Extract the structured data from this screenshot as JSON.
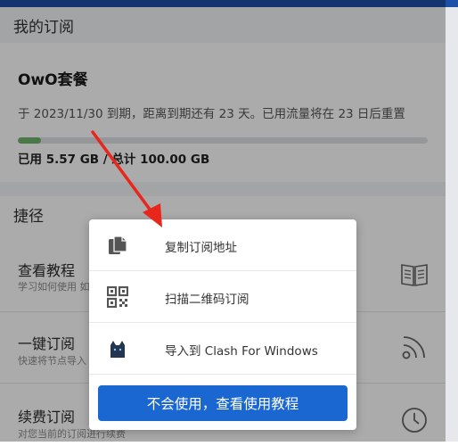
{
  "subscription": {
    "header": "我的订阅",
    "plan_name": "OwO套餐",
    "desc": "于 2023/11/30 到期，距离到期还有 23 天。已用流量将在 23 日后重置",
    "usage": "已用 5.57 GB / 总计 100.00 GB",
    "usage_fraction": 0.0557,
    "progress_color": "#6fb36a"
  },
  "shortcuts": {
    "header": "捷径",
    "items": [
      {
        "title": "查看教程",
        "subtitle": "学习如何使用 如",
        "icon": "book-icon"
      },
      {
        "title": "一键订阅",
        "subtitle": "快速将节点导入",
        "icon": "rss-icon"
      },
      {
        "title": "续费订阅",
        "subtitle": "对您当前的订阅进行续费",
        "icon": "clock-icon"
      }
    ]
  },
  "popup": {
    "items": [
      {
        "label": "复制订阅地址",
        "icon": "copy-icon"
      },
      {
        "label": "扫描二维码订阅",
        "icon": "qrcode-icon"
      },
      {
        "label": "导入到 Clash For Windows",
        "icon": "clash-cat-icon"
      }
    ],
    "button": "不会使用，查看使用教程",
    "button_color": "#1a67d2"
  },
  "colors": {
    "topbar": "#1c4fa6",
    "annotation_arrow": "#e8261b"
  }
}
